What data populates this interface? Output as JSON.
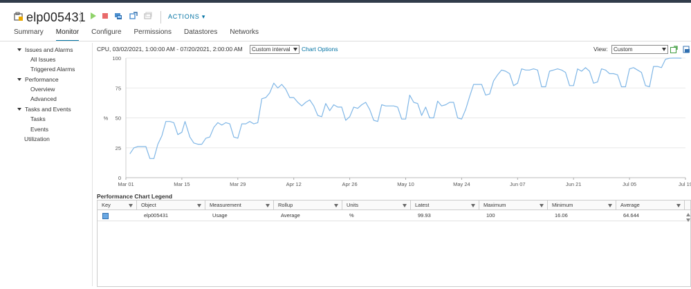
{
  "header": {
    "vm_name": "elp005431",
    "actions_label": "ACTIONS",
    "actions_caret": "▾"
  },
  "tabs": [
    {
      "label": "Summary"
    },
    {
      "label": "Monitor",
      "active": true
    },
    {
      "label": "Configure"
    },
    {
      "label": "Permissions"
    },
    {
      "label": "Datastores"
    },
    {
      "label": "Networks"
    }
  ],
  "sidebar": {
    "issues_alarms": "Issues and Alarms",
    "all_issues": "All Issues",
    "triggered_alarms": "Triggered Alarms",
    "performance": "Performance",
    "overview": "Overview",
    "advanced": "Advanced",
    "tasks_events": "Tasks and Events",
    "tasks": "Tasks",
    "events": "Events",
    "utilization": "Utilization"
  },
  "toolbar": {
    "chart_title": "CPU, 03/02/2021, 1:00:00 AM - 07/20/2021, 2:00:00 AM",
    "interval_value": "Custom interval",
    "chart_options_label": "Chart Options",
    "view_label": "View:",
    "view_value": "Custom"
  },
  "chart_data": {
    "type": "line",
    "ylabel": "%",
    "ylim": [
      0,
      100
    ],
    "yticks": [
      0,
      25,
      50,
      75,
      100
    ],
    "xticks": [
      "Mar 01",
      "Mar 15",
      "Mar 29",
      "Apr 12",
      "Apr 26",
      "May 10",
      "May 24",
      "Jun 07",
      "Jun 21",
      "Jul 05",
      "Jul 19"
    ],
    "xlim_days": [
      0,
      140
    ],
    "line_color": "#7fb6e6",
    "grid": "horizontal",
    "series": [
      {
        "name": "Usage",
        "points": [
          [
            1,
            20
          ],
          [
            2,
            25
          ],
          [
            3,
            26
          ],
          [
            4,
            26
          ],
          [
            5,
            26
          ],
          [
            6,
            16
          ],
          [
            7,
            16
          ],
          [
            8,
            28
          ],
          [
            9,
            35
          ],
          [
            10,
            47
          ],
          [
            11,
            47
          ],
          [
            12,
            46
          ],
          [
            13,
            36
          ],
          [
            14,
            38
          ],
          [
            14.8,
            47
          ],
          [
            16,
            34
          ],
          [
            17,
            29
          ],
          [
            18,
            28
          ],
          [
            19,
            28
          ],
          [
            20,
            33
          ],
          [
            21,
            34
          ],
          [
            22,
            42
          ],
          [
            23,
            46
          ],
          [
            24,
            44
          ],
          [
            25,
            46
          ],
          [
            26,
            45
          ],
          [
            27,
            34
          ],
          [
            28,
            33
          ],
          [
            29,
            45
          ],
          [
            30,
            45
          ],
          [
            31,
            47
          ],
          [
            32,
            45
          ],
          [
            33,
            46
          ],
          [
            34,
            66
          ],
          [
            35,
            67
          ],
          [
            36,
            71
          ],
          [
            37,
            79
          ],
          [
            38,
            75
          ],
          [
            39,
            78
          ],
          [
            40,
            74
          ],
          [
            41,
            67
          ],
          [
            42,
            67
          ],
          [
            43,
            63
          ],
          [
            44,
            60
          ],
          [
            45,
            63
          ],
          [
            46,
            65
          ],
          [
            47,
            60
          ],
          [
            48,
            52
          ],
          [
            49,
            51
          ],
          [
            50,
            62
          ],
          [
            51,
            56
          ],
          [
            52,
            61
          ],
          [
            53,
            59
          ],
          [
            54,
            59
          ],
          [
            55,
            48
          ],
          [
            56,
            51
          ],
          [
            57,
            59
          ],
          [
            58,
            58
          ],
          [
            59,
            61
          ],
          [
            60,
            63
          ],
          [
            61,
            57
          ],
          [
            62,
            48
          ],
          [
            63,
            47
          ],
          [
            64,
            61
          ],
          [
            65,
            60
          ],
          [
            66,
            60
          ],
          [
            67,
            60
          ],
          [
            68,
            59
          ],
          [
            69,
            49
          ],
          [
            70,
            49
          ],
          [
            71,
            69
          ],
          [
            72,
            63
          ],
          [
            73,
            62
          ],
          [
            74,
            52
          ],
          [
            75,
            59
          ],
          [
            76,
            50
          ],
          [
            77,
            50
          ],
          [
            78,
            64
          ],
          [
            79,
            60
          ],
          [
            80,
            61
          ],
          [
            81,
            63
          ],
          [
            82,
            63
          ],
          [
            83,
            50
          ],
          [
            84,
            49
          ],
          [
            85,
            57
          ],
          [
            86,
            68
          ],
          [
            87,
            78
          ],
          [
            88,
            78
          ],
          [
            89,
            78
          ],
          [
            90,
            69
          ],
          [
            91,
            70
          ],
          [
            92,
            81
          ],
          [
            93,
            86
          ],
          [
            94,
            90
          ],
          [
            95,
            89
          ],
          [
            96,
            87
          ],
          [
            97,
            77
          ],
          [
            98,
            79
          ],
          [
            99,
            91
          ],
          [
            100,
            90
          ],
          [
            101,
            90
          ],
          [
            102,
            91
          ],
          [
            103,
            90
          ],
          [
            104,
            76
          ],
          [
            105,
            76
          ],
          [
            106,
            89
          ],
          [
            107,
            90
          ],
          [
            108,
            91
          ],
          [
            109,
            90
          ],
          [
            110,
            88
          ],
          [
            111,
            77
          ],
          [
            112,
            77
          ],
          [
            113,
            91
          ],
          [
            114,
            89
          ],
          [
            115,
            92
          ],
          [
            116,
            89
          ],
          [
            117,
            79
          ],
          [
            118,
            80
          ],
          [
            119,
            91
          ],
          [
            120,
            90
          ],
          [
            121,
            87
          ],
          [
            122,
            87
          ],
          [
            123,
            86
          ],
          [
            124,
            76
          ],
          [
            125,
            76
          ],
          [
            126,
            91
          ],
          [
            127,
            92
          ],
          [
            128,
            90
          ],
          [
            129,
            88
          ],
          [
            130,
            77
          ],
          [
            131,
            76
          ],
          [
            132,
            93
          ],
          [
            133,
            93
          ],
          [
            134,
            92
          ],
          [
            135,
            99
          ],
          [
            136,
            99.9
          ],
          [
            137,
            100
          ],
          [
            138,
            100
          ],
          [
            139,
            99.93
          ]
        ]
      }
    ]
  },
  "legend": {
    "title": "Performance Chart Legend",
    "columns": [
      "Key",
      "Object",
      "Measurement",
      "Rollup",
      "Units",
      "Latest",
      "Maximum",
      "Minimum",
      "Average"
    ],
    "rows": [
      {
        "object": "elp005431",
        "measurement": "Usage",
        "rollup": "Average",
        "units": "%",
        "latest": "99.93",
        "maximum": "100",
        "minimum": "16.06",
        "average": "64.644",
        "key_color": "#6aa8e3"
      }
    ]
  },
  "colors": {
    "accent": "#0072a3",
    "topbar": "#313c4a"
  }
}
